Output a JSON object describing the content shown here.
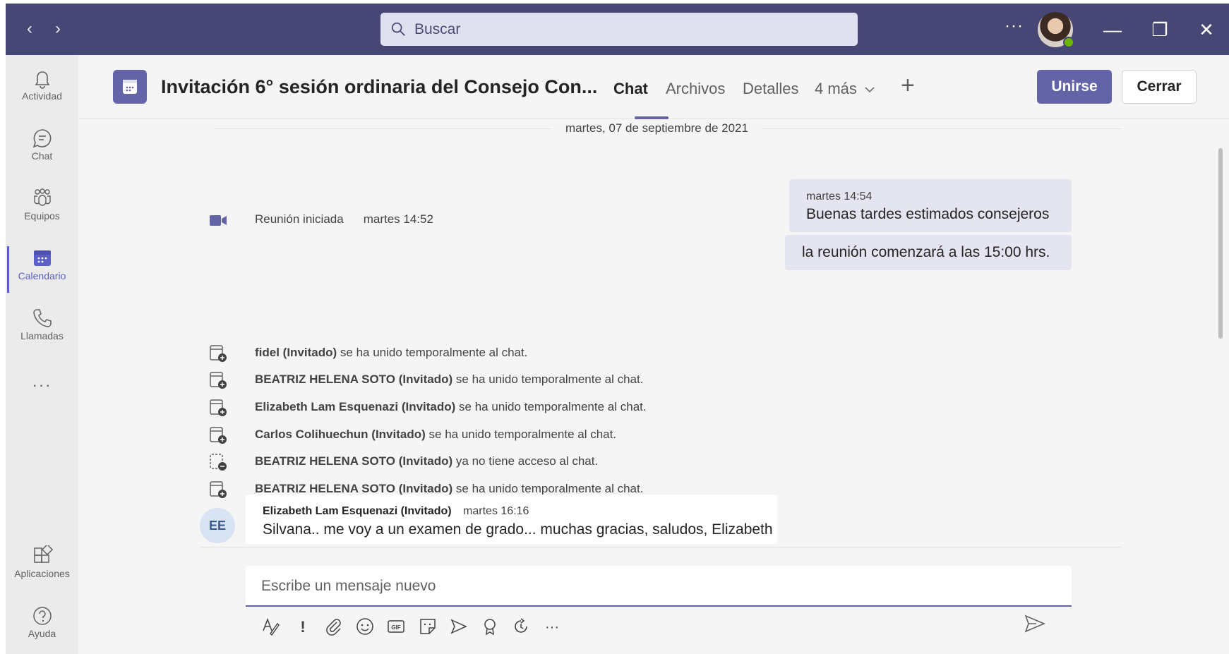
{
  "titlebar": {
    "search_placeholder": "Buscar",
    "more_label": "···",
    "back_glyph": "‹",
    "forward_glyph": "›",
    "minimize_glyph": "—",
    "maximize_glyph": "❐",
    "close_glyph": "✕",
    "presence_status_color": "#6bb700"
  },
  "rail": {
    "items": [
      {
        "label": "Actividad",
        "icon": "bell-icon"
      },
      {
        "label": "Chat",
        "icon": "chat-icon"
      },
      {
        "label": "Equipos",
        "icon": "teams-icon"
      },
      {
        "label": "Calendario",
        "icon": "calendar-icon",
        "active": true
      },
      {
        "label": "Llamadas",
        "icon": "phone-icon"
      }
    ],
    "more_label": "···",
    "bottom": [
      {
        "label": "Aplicaciones",
        "icon": "apps-icon"
      },
      {
        "label": "Ayuda",
        "icon": "help-icon"
      }
    ]
  },
  "header": {
    "title": "Invitación 6° sesión ordinaria del Consejo Con...",
    "tabs": [
      {
        "label": "Chat",
        "active": true
      },
      {
        "label": "Archivos"
      },
      {
        "label": "Detalles"
      },
      {
        "label": "4 más"
      }
    ],
    "add_tab_label": "+",
    "join_label": "Unirse",
    "close_label": "Cerrar",
    "accent": "#6264a7"
  },
  "messages": {
    "date_divider": "martes, 07 de septiembre de 2021",
    "meeting_started": {
      "text": "Reunión iniciada",
      "time": "martes 14:52"
    },
    "outgoing": [
      {
        "time": "martes 14:54",
        "text": "Buenas tardes estimados consejeros"
      },
      {
        "text": "la reunión comenzará a las 15:00 hrs."
      }
    ],
    "system_events": [
      {
        "name": "fidel (Invitado)",
        "text": " se ha unido temporalmente al chat."
      },
      {
        "name": "BEATRIZ HELENA SOTO (Invitado)",
        "text": " se ha unido temporalmente al chat."
      },
      {
        "name": "Elizabeth Lam Esquenazi (Invitado)",
        "text": " se ha unido temporalmente al chat."
      },
      {
        "name": "Carlos Colihuechun (Invitado)",
        "text": " se ha unido temporalmente al chat."
      },
      {
        "name": "BEATRIZ HELENA SOTO (Invitado)",
        "text": " ya no tiene acceso al chat."
      },
      {
        "name": "BEATRIZ HELENA SOTO (Invitado)",
        "text": " se ha unido temporalmente al chat."
      }
    ],
    "incoming": {
      "initials": "EE",
      "author": "Elizabeth Lam Esquenazi (Invitado)",
      "time": "martes 16:16",
      "text": "Silvana.. me voy a un examen de grado... muchas gracias, saludos, Elizabeth"
    }
  },
  "compose": {
    "placeholder": "Escribe un mensaje nuevo",
    "tools": [
      "format-icon",
      "important-icon",
      "attach-icon",
      "emoji-icon",
      "gif-icon",
      "sticker-icon",
      "meet-now-icon",
      "praise-icon",
      "loop-icon",
      "more-options-icon"
    ],
    "gif_label": "GIF",
    "important_label": "!",
    "more_label": "···"
  }
}
